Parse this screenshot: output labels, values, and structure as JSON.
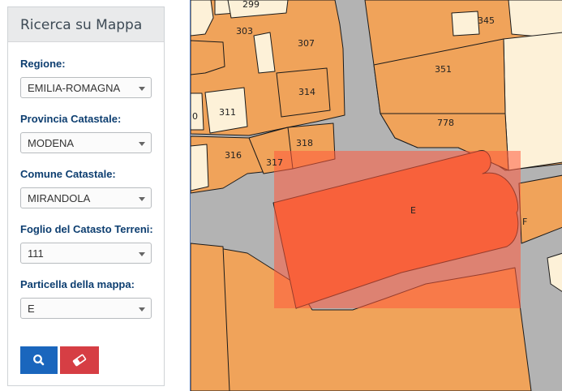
{
  "panel": {
    "title": "Ricerca su Mappa",
    "fields": [
      {
        "label": "Regione:",
        "value": "EMILIA-ROMAGNA"
      },
      {
        "label": "Provincia Catastale:",
        "value": "MODENA"
      },
      {
        "label": "Comune Catastale:",
        "value": "MIRANDOLA"
      },
      {
        "label": "Foglio del Catasto Terreni:",
        "value": "111"
      },
      {
        "label": "Particella della mappa:",
        "value": "E"
      }
    ],
    "buttons": {
      "search_icon": "search-icon",
      "clear_icon": "eraser-icon"
    }
  },
  "map": {
    "parcel_labels": [
      "299",
      "303",
      "307",
      "345",
      "351",
      "314",
      "311",
      "0",
      "778",
      "318",
      "316",
      "317",
      "E",
      "F"
    ],
    "colors": {
      "road": "#b3b3b3",
      "parcel": "#f0a35a",
      "building_light": "#fdf1d8",
      "highlight": "#ff5a3c",
      "border": "#1a1a1a",
      "brand_blue": "#1a66bd",
      "clear_red": "#d63e44"
    }
  }
}
